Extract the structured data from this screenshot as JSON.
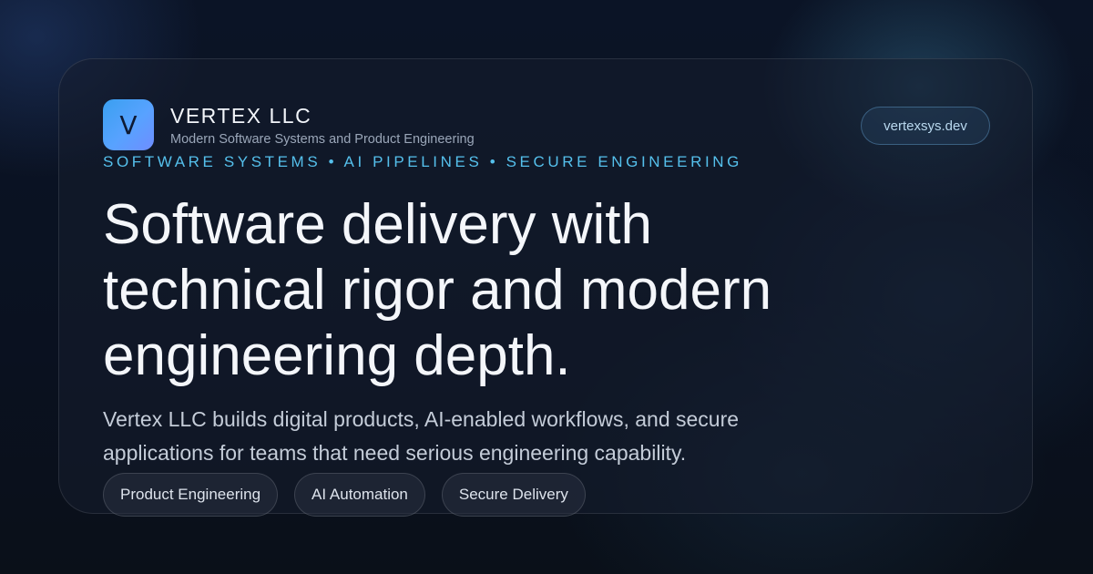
{
  "brand": {
    "logo_letter": "V",
    "name": "VERTEX LLC",
    "tagline": "Modern Software Systems and Product Engineering"
  },
  "domain_pill": "vertexsys.dev",
  "kicker": "SOFTWARE SYSTEMS • AI PIPELINES • SECURE ENGINEERING",
  "headline": {
    "line1": "Software delivery with",
    "line2": "technical rigor and modern",
    "line3": "engineering depth."
  },
  "description": {
    "line1": "Vertex LLC builds digital products, AI-enabled workflows, and secure",
    "line2": "applications for teams that need serious engineering capability."
  },
  "tags": [
    {
      "label": "Product Engineering"
    },
    {
      "label": "AI Automation"
    },
    {
      "label": "Secure Delivery"
    }
  ],
  "colors": {
    "background": "#0a1120",
    "accent": "#55c0ec",
    "logo_gradient_start": "#3aa0f0",
    "logo_gradient_end": "#6f8dff"
  }
}
